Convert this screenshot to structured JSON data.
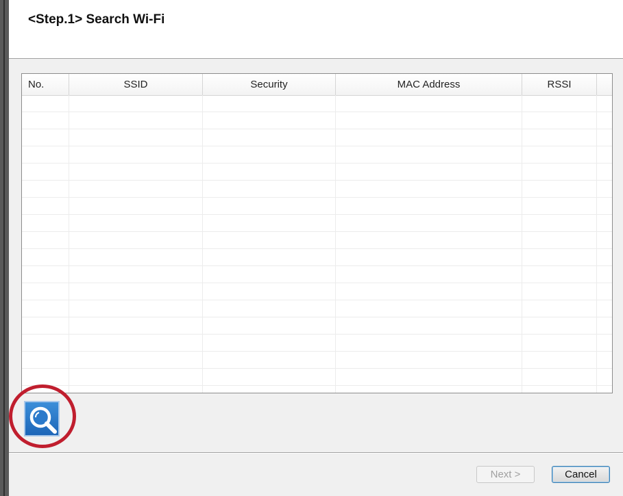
{
  "dialog": {
    "step_title": "<Step.1>  Search Wi-Fi"
  },
  "table": {
    "columns": [
      "No.",
      "SSID",
      "Security",
      "MAC Address",
      "RSSI"
    ],
    "rows": []
  },
  "search_button": {
    "icon": "magnifier-icon",
    "highlighted": true,
    "highlight_color": "#c01e2e"
  },
  "footer": {
    "next_label": "Next >",
    "next_enabled": false,
    "cancel_label": "Cancel"
  }
}
